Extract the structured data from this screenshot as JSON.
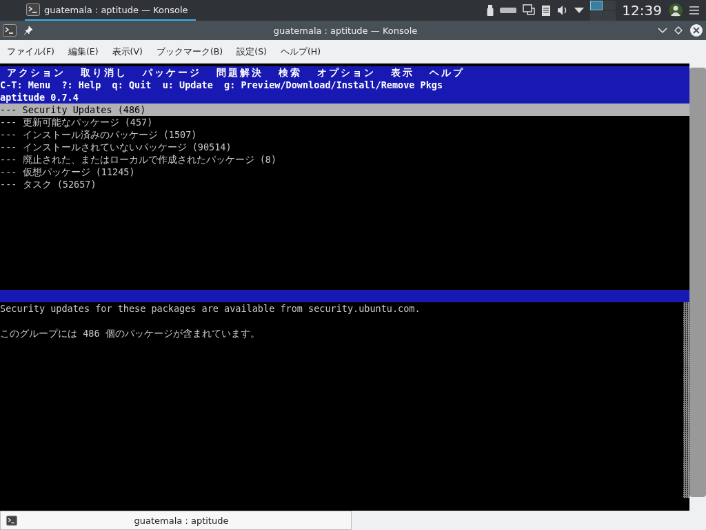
{
  "panel": {
    "tasks": [
      {
        "label": "guatemala : aptitude — Konsole",
        "selected": true
      }
    ],
    "clock": "12:39"
  },
  "window": {
    "title": "guatemala : aptitude — Konsole"
  },
  "menubar": [
    "ファイル(F)",
    "編集(E)",
    "表示(V)",
    "ブックマーク(B)",
    "設定(S)",
    "ヘルプ(H)"
  ],
  "terminal": {
    "menu": [
      "アクション",
      "取り消し",
      "パッケージ",
      "問題解決",
      "検索",
      "オプション",
      "表示",
      "ヘルプ"
    ],
    "keys": "C-T: Menu  ?: Help  q: Quit  u: Update  g: Preview/Download/Install/Remove Pkgs",
    "version": "aptitude 0.7.4",
    "rows": [
      {
        "text": "--- Security Updates (486)",
        "selected": true
      },
      {
        "text": "--- 更新可能なパッケージ (457)",
        "selected": false
      },
      {
        "text": "--- インストール済みのパッケージ (1507)",
        "selected": false
      },
      {
        "text": "--- インストールされていないパッケージ (90514)",
        "selected": false
      },
      {
        "text": "--- 廃止された、またはローカルで作成されたパッケージ (8)",
        "selected": false
      },
      {
        "text": "--- 仮想パッケージ (11245)",
        "selected": false
      },
      {
        "text": "--- タスク (52657)",
        "selected": false
      }
    ],
    "info": [
      "Security updates for these packages are available from security.ubuntu.com.",
      "このグループには 486 個のパッケージが含まれています。"
    ]
  },
  "tabs": [
    {
      "label": "guatemala : aptitude",
      "selected": true
    }
  ]
}
